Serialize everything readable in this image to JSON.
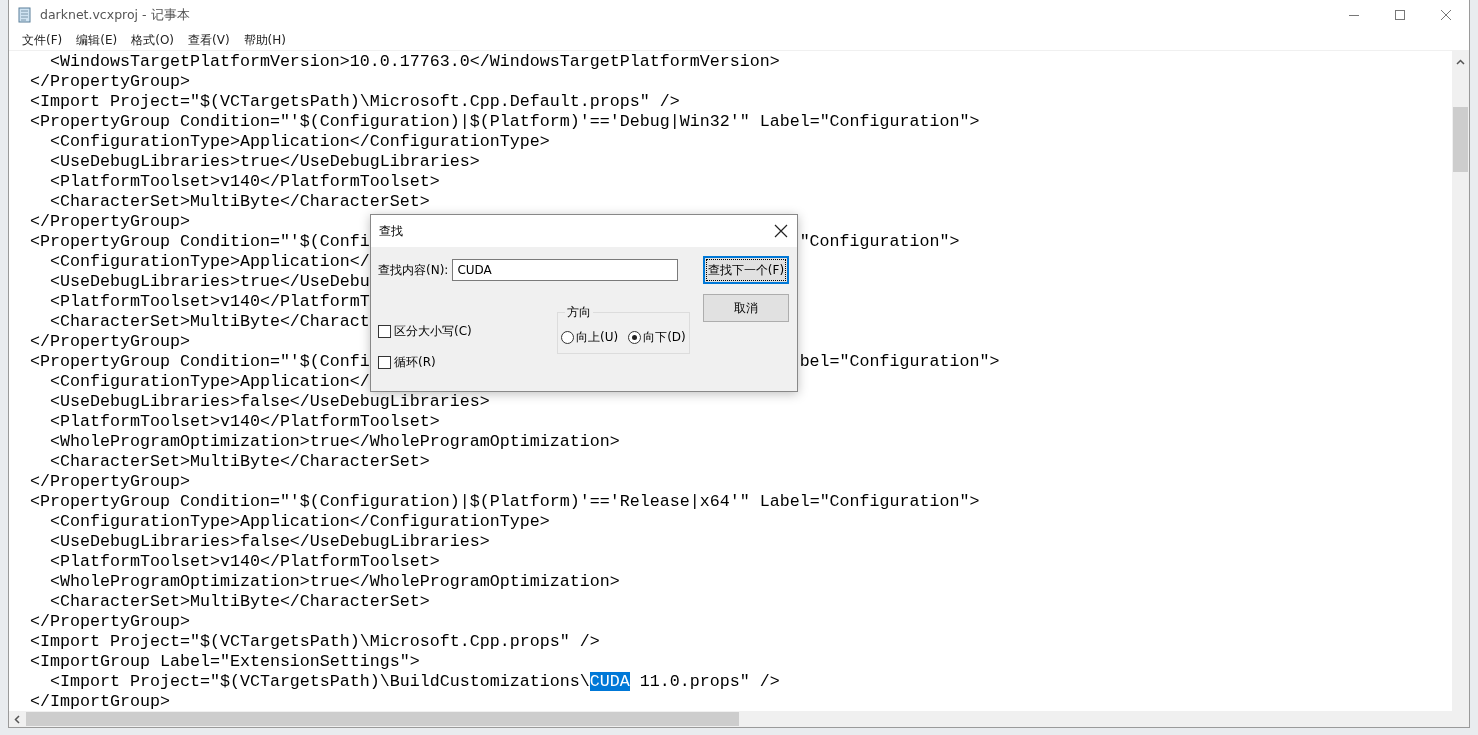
{
  "window": {
    "title": "darknet.vcxproj - 记事本"
  },
  "menu": [
    {
      "label": "文件(F)"
    },
    {
      "label": "编辑(E)"
    },
    {
      "label": "格式(O)"
    },
    {
      "label": "查看(V)"
    },
    {
      "label": "帮助(H)"
    }
  ],
  "editor": {
    "lines": [
      {
        "kind": "plain",
        "text": "    <WindowsTargetPlatformVersion>10.0.17763.0</WindowsTargetPlatformVersion>"
      },
      {
        "kind": "plain",
        "text": "  </PropertyGroup>"
      },
      {
        "kind": "plain",
        "text": "  <Import Project=\"$(VCTargetsPath)\\Microsoft.Cpp.Default.props\" />"
      },
      {
        "kind": "plain",
        "text": "  <PropertyGroup Condition=\"'$(Configuration)|$(Platform)'=='Debug|Win32'\" Label=\"Configuration\">"
      },
      {
        "kind": "plain",
        "text": "    <ConfigurationType>Application</ConfigurationType>"
      },
      {
        "kind": "plain",
        "text": "    <UseDebugLibraries>true</UseDebugLibraries>"
      },
      {
        "kind": "plain",
        "text": "    <PlatformToolset>v140</PlatformToolset>"
      },
      {
        "kind": "plain",
        "text": "    <CharacterSet>MultiByte</CharacterSet>"
      },
      {
        "kind": "plain",
        "text": "  </PropertyGroup>"
      },
      {
        "kind": "covered",
        "left": "  <PropertyGroup Condition=\"'$(Confi",
        "right": "\"Configuration\">"
      },
      {
        "kind": "covered",
        "left": "    <ConfigurationType>Application</"
      },
      {
        "kind": "covered",
        "left": "    <UseDebugLibraries>true</UseDebu"
      },
      {
        "kind": "covered",
        "left": "    <PlatformToolset>v140</PlatformT"
      },
      {
        "kind": "covered",
        "left": "    <CharacterSet>MultiByte</Charact"
      },
      {
        "kind": "plain",
        "text": "  </PropertyGroup>"
      },
      {
        "kind": "covered",
        "left": "  <PropertyGroup Condition=\"'$(Confi",
        "right": "bel=\"Configuration\">"
      },
      {
        "kind": "covered",
        "left": "    <ConfigurationType>Application</"
      },
      {
        "kind": "plain",
        "text": "    <UseDebugLibraries>false</UseDebugLibraries>"
      },
      {
        "kind": "plain",
        "text": "    <PlatformToolset>v140</PlatformToolset>"
      },
      {
        "kind": "plain",
        "text": "    <WholeProgramOptimization>true</WholeProgramOptimization>"
      },
      {
        "kind": "plain",
        "text": "    <CharacterSet>MultiByte</CharacterSet>"
      },
      {
        "kind": "plain",
        "text": "  </PropertyGroup>"
      },
      {
        "kind": "plain",
        "text": "  <PropertyGroup Condition=\"'$(Configuration)|$(Platform)'=='Release|x64'\" Label=\"Configuration\">"
      },
      {
        "kind": "plain",
        "text": "    <ConfigurationType>Application</ConfigurationType>"
      },
      {
        "kind": "plain",
        "text": "    <UseDebugLibraries>false</UseDebugLibraries>"
      },
      {
        "kind": "plain",
        "text": "    <PlatformToolset>v140</PlatformToolset>"
      },
      {
        "kind": "plain",
        "text": "    <WholeProgramOptimization>true</WholeProgramOptimization>"
      },
      {
        "kind": "plain",
        "text": "    <CharacterSet>MultiByte</CharacterSet>"
      },
      {
        "kind": "plain",
        "text": "  </PropertyGroup>"
      },
      {
        "kind": "plain",
        "text": "  <Import Project=\"$(VCTargetsPath)\\Microsoft.Cpp.props\" />"
      },
      {
        "kind": "plain",
        "text": "  <ImportGroup Label=\"ExtensionSettings\">"
      },
      {
        "kind": "segments",
        "segments": [
          {
            "text": "    <Import Project=\"$(VCTargetsPath)\\BuildCustomizations\\",
            "selected": false
          },
          {
            "text": "CUDA",
            "selected": true
          },
          {
            "text": " 11.0.props\" />",
            "selected": false
          }
        ]
      },
      {
        "kind": "plain",
        "text": "  </ImportGroup>"
      }
    ]
  },
  "find_dialog": {
    "title": "查找",
    "find_label": "查找内容(N):",
    "find_value": "CUDA",
    "buttons": [
      {
        "label": "查找下一个(F)",
        "default": true
      },
      {
        "label": "取消",
        "default": false
      }
    ],
    "direction": {
      "label": "方向",
      "options": [
        {
          "label": "向上(U)",
          "selected": false
        },
        {
          "label": "向下(D)",
          "selected": true
        }
      ]
    },
    "options": [
      {
        "label": "区分大小写(C)",
        "checked": false
      },
      {
        "label": "循环(R)",
        "checked": false
      }
    ]
  }
}
